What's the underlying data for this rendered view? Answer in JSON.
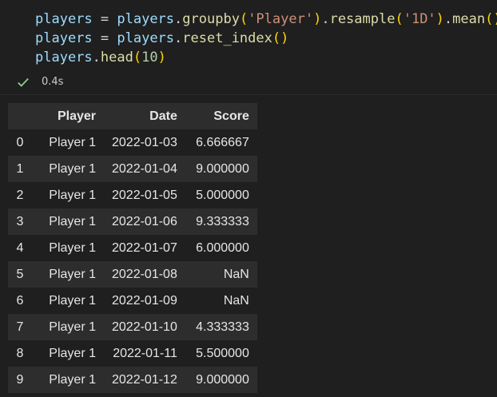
{
  "code": {
    "line1": {
      "a": "players",
      "eq": " = ",
      "b": "players",
      "dot1": ".",
      "fn1": "groupby",
      "p1o": "(",
      "s1": "'Player'",
      "p1c": ")",
      "dot2": ".",
      "fn2": "resample",
      "p2o": "(",
      "s2": "'1D'",
      "p2c": ")",
      "dot3": ".",
      "fn3": "mean",
      "p3": "()"
    },
    "line2": {
      "a": "players",
      "eq": " = ",
      "b": "players",
      "dot": ".",
      "fn": "reset_index",
      "p": "()"
    },
    "line3": {
      "a": "players",
      "dot": ".",
      "fn": "head",
      "po": "(",
      "num": "10",
      "pc": ")"
    }
  },
  "status": {
    "time": "0.4s",
    "success_color": "#89d185",
    "icon": "check-icon"
  },
  "table": {
    "columns": [
      "",
      "Player",
      "Date",
      "Score"
    ],
    "rows": [
      [
        "0",
        "Player 1",
        "2022-01-03",
        "6.666667"
      ],
      [
        "1",
        "Player 1",
        "2022-01-04",
        "9.000000"
      ],
      [
        "2",
        "Player 1",
        "2022-01-05",
        "5.000000"
      ],
      [
        "3",
        "Player 1",
        "2022-01-06",
        "9.333333"
      ],
      [
        "4",
        "Player 1",
        "2022-01-07",
        "6.000000"
      ],
      [
        "5",
        "Player 1",
        "2022-01-08",
        "NaN"
      ],
      [
        "6",
        "Player 1",
        "2022-01-09",
        "NaN"
      ],
      [
        "7",
        "Player 1",
        "2022-01-10",
        "4.333333"
      ],
      [
        "8",
        "Player 1",
        "2022-01-11",
        "5.500000"
      ],
      [
        "9",
        "Player 1",
        "2022-01-12",
        "9.000000"
      ]
    ]
  }
}
